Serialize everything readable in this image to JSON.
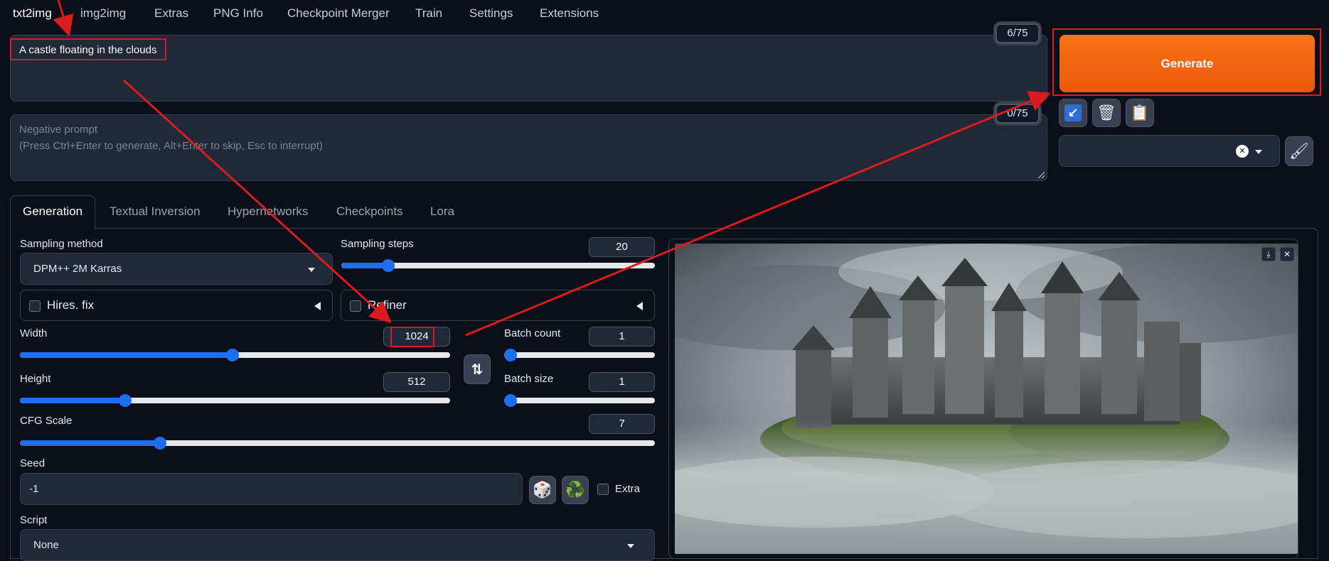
{
  "top_tabs": [
    "txt2img",
    "img2img",
    "Extras",
    "PNG Info",
    "Checkpoint Merger",
    "Train",
    "Settings",
    "Extensions"
  ],
  "prompt": {
    "value": "A castle floating in the clouds",
    "counter": "6/75"
  },
  "negative_prompt": {
    "placeholder_line1": "Negative prompt",
    "placeholder_line2": "(Press Ctrl+Enter to generate, Alt+Enter to skip, Esc to interrupt)",
    "counter": "0/75"
  },
  "generate_label": "Generate",
  "tool_icons": [
    "↙",
    "🗑",
    "📋"
  ],
  "style_clear": "✕",
  "paint_icon": "🖌",
  "sub_tabs": [
    "Generation",
    "Textual Inversion",
    "Hypernetworks",
    "Checkpoints",
    "Lora"
  ],
  "sampling_method": {
    "label": "Sampling method",
    "value": "DPM++ 2M Karras"
  },
  "sampling_steps": {
    "label": "Sampling steps",
    "value": "20",
    "fraction": 0.13
  },
  "hires_fix": {
    "label": "Hires. fix"
  },
  "refiner": {
    "label": "Refiner"
  },
  "width": {
    "label": "Width",
    "value": "1024",
    "fraction": 0.48
  },
  "height": {
    "label": "Height",
    "value": "512",
    "fraction": 0.23
  },
  "swap_icon": "⇅",
  "batch_count": {
    "label": "Batch count",
    "value": "1",
    "fraction": 0.0
  },
  "batch_size": {
    "label": "Batch size",
    "value": "1",
    "fraction": 0.0
  },
  "cfg_scale": {
    "label": "CFG Scale",
    "value": "7",
    "fraction": 0.21
  },
  "seed": {
    "label": "Seed",
    "value": "-1"
  },
  "dice_icon": "🎲",
  "recycle_icon": "♻️",
  "extra_label": "Extra",
  "script": {
    "label": "Script",
    "value": "None"
  },
  "image_download_icon": "⤓",
  "image_close_icon": "✕",
  "colors": {
    "accent": "#1d6ff2",
    "generate": "#f97316",
    "annotation": "#dc1c1c"
  }
}
